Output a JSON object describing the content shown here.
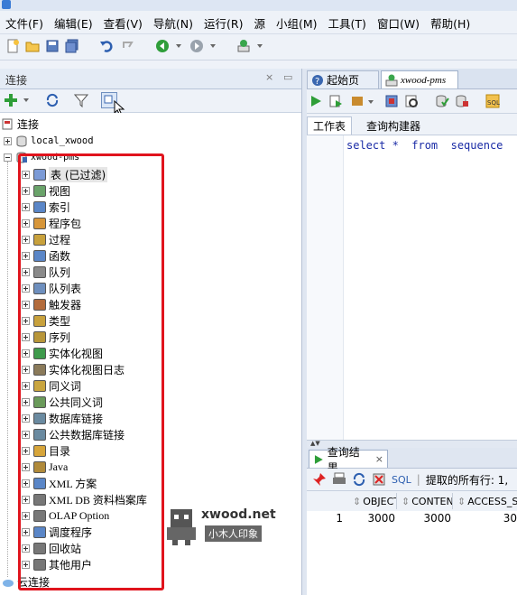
{
  "menu": [
    "文件(F)",
    "编辑(E)",
    "查看(V)",
    "导航(N)",
    "运行(R)",
    "源",
    "小组(M)",
    "工具(T)",
    "窗口(W)",
    "帮助(H)"
  ],
  "left_panel": {
    "title": "连接"
  },
  "tree": {
    "root_label": "连接",
    "conn1": "local_xwood",
    "conn2": "xwood-pms",
    "cloud": "云连接",
    "items": [
      "表 (已过滤)",
      "视图",
      "索引",
      "程序包",
      "过程",
      "函数",
      "队列",
      "队列表",
      "触发器",
      "类型",
      "序列",
      "实体化视图",
      "实体化视图日志",
      "同义词",
      "公共同义词",
      "数据库链接",
      "公共数据库链接",
      "目录",
      "Java",
      "XML 方案",
      "XML DB 资料档案库",
      "OLAP Option",
      "调度程序",
      "回收站",
      "其他用户"
    ]
  },
  "tabs": {
    "start": "起始页",
    "worksheet": "xwood-pms"
  },
  "subtabs": {
    "worksheet": "工作表",
    "query_builder": "查询构建器"
  },
  "editor": {
    "code": "select *  from  sequence"
  },
  "results": {
    "tab_label": "查询结果",
    "sql_label": "SQL",
    "status": "提取的所有行: 1,",
    "columns": [
      "OBJECT",
      "CONTENT",
      "ACCESS_STA"
    ],
    "rows": [
      {
        "num": "1",
        "cells": [
          "3000",
          "3000",
          "30"
        ]
      }
    ]
  },
  "watermark": {
    "site": "xwood.net",
    "cn": "小木人印象"
  },
  "colors": {
    "highlight_box": "#e0141d",
    "keyword": "#1a2ba6"
  }
}
